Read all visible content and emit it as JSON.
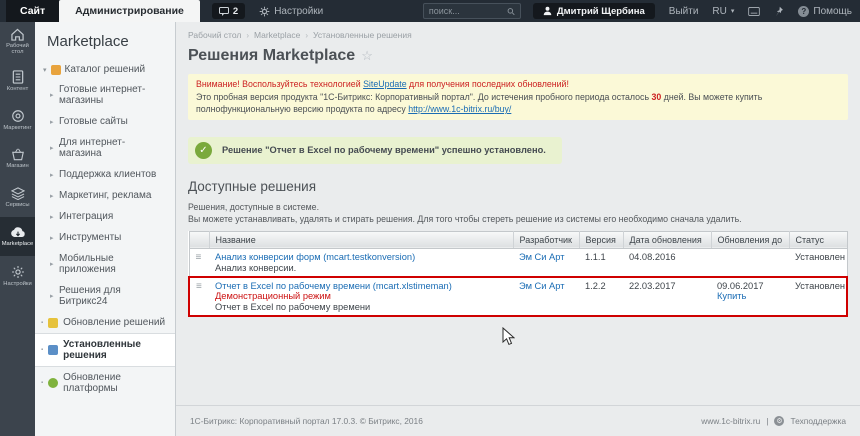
{
  "topbar": {
    "tab_site": "Сайт",
    "tab_admin": "Администрирование",
    "notifications_count": "2",
    "settings_label": "Настройки",
    "search_placeholder": "поиск...",
    "user_name": "Дмитрий Щербина",
    "logout_label": "Выйти",
    "lang_label": "RU",
    "help_label": "Помощь"
  },
  "rail": {
    "items": [
      {
        "label": "Рабочий стол"
      },
      {
        "label": "Контент"
      },
      {
        "label": "Маркетинг"
      },
      {
        "label": "Магазин"
      },
      {
        "label": "Сервисы"
      },
      {
        "label": "Marketplace"
      },
      {
        "label": "Настройки"
      }
    ]
  },
  "sidebar": {
    "title": "Marketplace",
    "root_item": "Каталог решений",
    "children": [
      "Готовые интернет-магазины",
      "Готовые сайты",
      "Для интернет-магазина",
      "Поддержка клиентов",
      "Маркетинг, реклама",
      "Интеграция",
      "Инструменты",
      "Мобильные приложения",
      "Решения для Битрикс24"
    ],
    "bottom_items": [
      {
        "label": "Обновление решений"
      },
      {
        "label": "Установленные решения"
      },
      {
        "label": "Обновление платформы"
      }
    ]
  },
  "breadcrumb": {
    "items": [
      "Рабочий стол",
      "Marketplace",
      "Установленные решения"
    ]
  },
  "page": {
    "title": "Решения Marketplace"
  },
  "warning": {
    "line1_pre": "Внимание! Воспользуйтесь технологией",
    "line1_link": "SiteUpdate",
    "line1_post": "для получения последних обновлений!",
    "line2_pre": "Это пробная версия продукта \"1С-Битрикс: Корпоративный портал\". До истечения пробного периода осталось",
    "days": "30",
    "line2_mid": "дней. Вы можете купить полнофункциональную версию продукта по адресу",
    "line2_link": "http://www.1c-bitrix.ru/buy/"
  },
  "success": {
    "message": "Решение \"Отчет в Excel по рабочему времени\" успешно установлено."
  },
  "section": {
    "title": "Доступные решения",
    "desc_line1": "Решения, доступные в системе.",
    "desc_line2": "Вы можете устанавливать, удалять и стирать решения. Для того чтобы стереть решение из системы его необходимо сначала удалить."
  },
  "table": {
    "headers": [
      "Название",
      "Разработчик",
      "Версия",
      "Дата обновления",
      "Обновления до",
      "Статус"
    ],
    "rows": [
      {
        "name_link": "Анализ конверсии форм (mcart.testkonversion)",
        "name_note": "",
        "name_sub": "Анализ конверсии.",
        "developer": "Эм Си Арт",
        "version": "1.1.1",
        "updated": "04.08.2016",
        "update_until": "",
        "buy_link": "",
        "status": "Установлен"
      },
      {
        "name_link": "Отчет в Excel по рабочему времени (mcart.xlstimeman)",
        "name_note": "Демонстрационный режим",
        "name_sub": "Отчет в Excel по рабочему времени",
        "developer": "Эм Си Арт",
        "version": "1.2.2",
        "updated": "22.03.2017",
        "update_until": "09.06.2017",
        "buy_link": "Купить",
        "status": "Установлен"
      }
    ]
  },
  "footer": {
    "left": "1С-Битрикс: Корпоративный портал 17.0.3. © Битрикс, 2016",
    "site_link": "www.1c-bitrix.ru",
    "support": "Техподдержка"
  },
  "icons": {
    "star": "☆",
    "hamburger": "≡",
    "check": "✓",
    "question": "?",
    "caret": "▾"
  },
  "colors": {
    "accent_red": "#cc0000",
    "link_blue": "#1a6cb4",
    "success_green": "#7aa93c",
    "topbar_dark": "#242c35"
  }
}
